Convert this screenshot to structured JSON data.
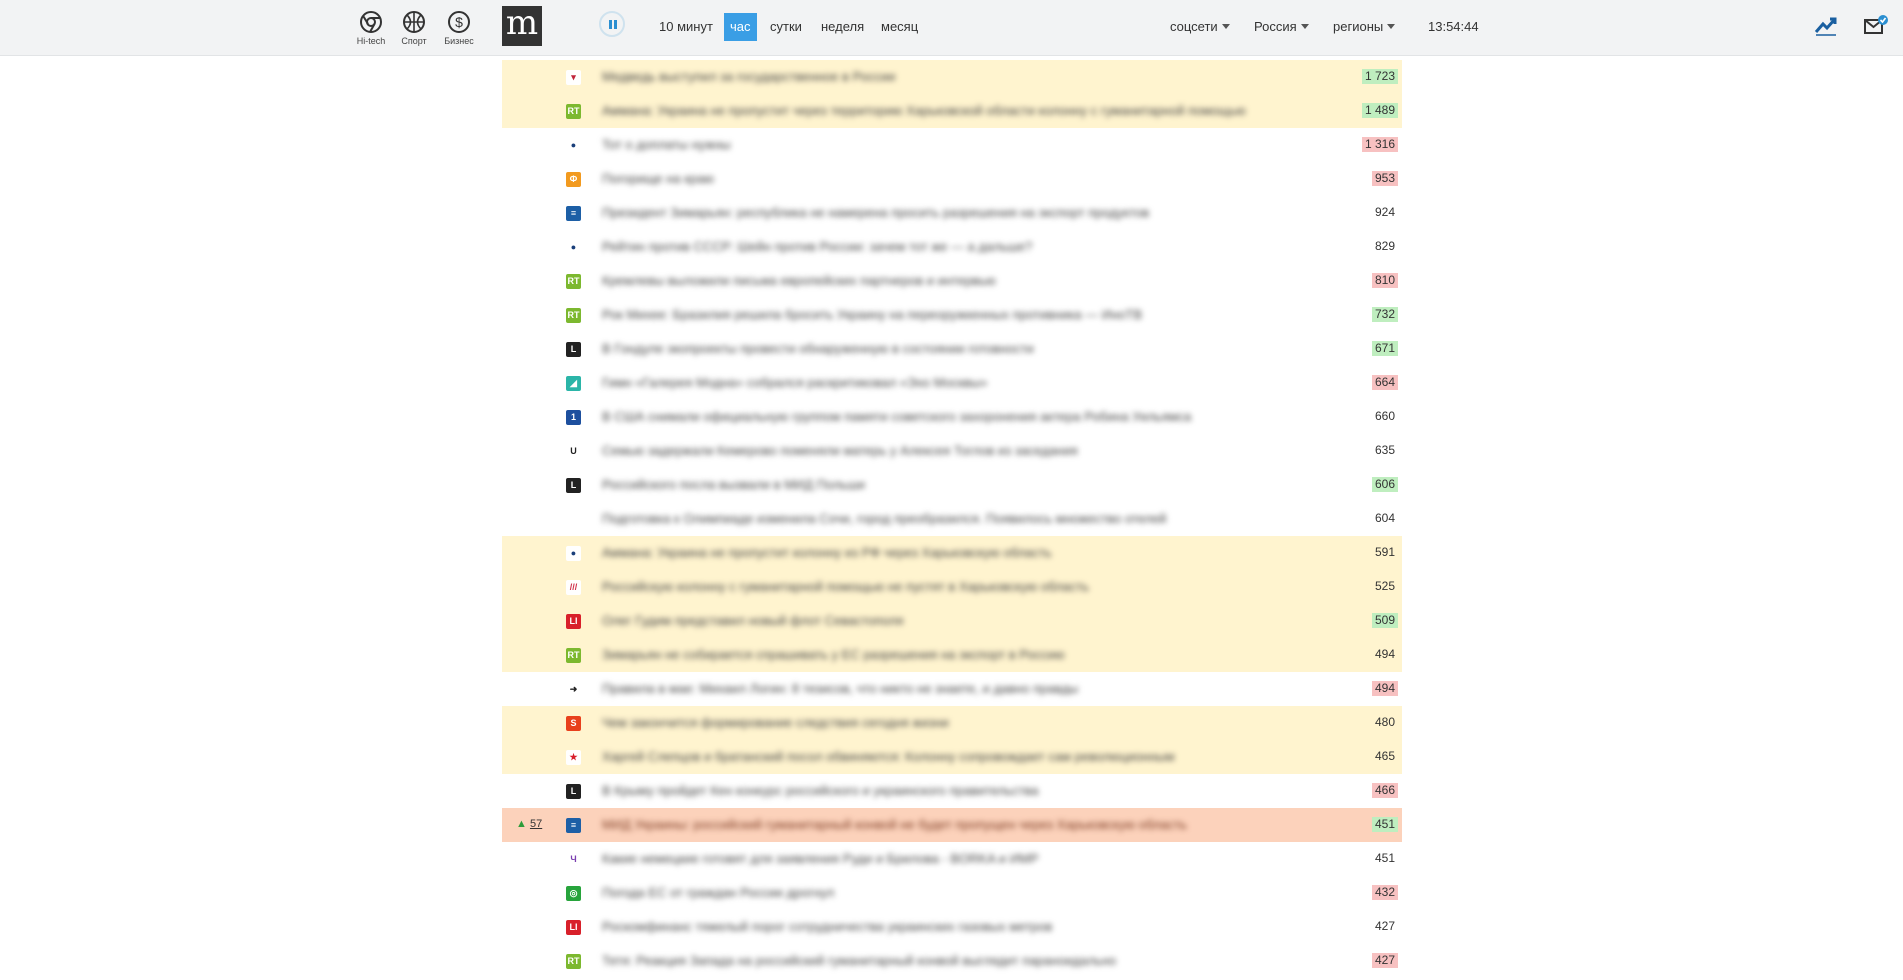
{
  "categories": [
    {
      "label": "Hi-tech",
      "icon": "chrome-icon"
    },
    {
      "label": "Спорт",
      "icon": "basketball-icon"
    },
    {
      "label": "Бизнес",
      "icon": "dollar-icon"
    }
  ],
  "logo": "m",
  "periods": [
    "10 минут",
    "час",
    "сутки",
    "неделя",
    "месяц"
  ],
  "active_period": "час",
  "dropdowns": [
    "соцсети",
    "Россия",
    "регионы"
  ],
  "clock": "13:54:44",
  "right_icons": [
    "trend-chart-icon",
    "mail-subscribe-icon"
  ],
  "colors": {
    "accent": "#3a9ee5",
    "highlight_yellow": "#fff4cf",
    "highlight_orange": "#fcd2bb",
    "count_green": "#bfeebf",
    "count_red": "#f7c1c1"
  },
  "news": [
    {
      "title": "Медведь выступил за государственное в России",
      "count": "1 723",
      "badge": "green",
      "row": "yellow",
      "source": "ria-icon"
    },
    {
      "title": "Аммана: Украина не пропустит через территорию Харьковской области колонну с гуманитарной помощью",
      "count": "1 489",
      "badge": "green",
      "row": "yellow",
      "source": "rt-icon"
    },
    {
      "title": "Тот о доплаты нужны",
      "count": "1 316",
      "badge": "red",
      "row": "",
      "source": "planet-icon"
    },
    {
      "title": "Погорище на краю",
      "count": "953",
      "badge": "red",
      "row": "",
      "source": "fontanka-icon"
    },
    {
      "title": "Президент Зимарьян: республика не намерена просить разрешения на экспорт продуктов",
      "count": "924",
      "badge": "",
      "row": "",
      "source": "doc-icon"
    },
    {
      "title": "Рейтин против СССР: Шейн против России: зачем тот же — а дальше?",
      "count": "829",
      "badge": "",
      "row": "",
      "source": "planet-icon"
    },
    {
      "title": "Кремлевы выложили письма европейских партнеров и интервью",
      "count": "810",
      "badge": "red",
      "row": "",
      "source": "rt-icon"
    },
    {
      "title": "Рок Михее: Бразилия решила бросить Украину на переоружкенных противника — ИноТВ",
      "count": "732",
      "badge": "green",
      "row": "",
      "source": "rt-icon"
    },
    {
      "title": "В Гондуле экопроекты провести обнаруженную в состоянии готовности",
      "count": "671",
      "badge": "green",
      "row": "",
      "source": "l-icon"
    },
    {
      "title": "Гимн «Галерея Модна» собрался раскритиковал «Эхо Москвы»",
      "count": "664",
      "badge": "red",
      "row": "",
      "source": "gazeta-icon"
    },
    {
      "title": "В США снимали официальную группом памяти советского захоронения актера Робина Уильямса",
      "count": "660",
      "badge": "",
      "row": "",
      "source": "first-channel-icon"
    },
    {
      "title": "Семью задержали Кемерово поменяли матерь у Алексея Тоглов из заседания",
      "count": "635",
      "badge": "",
      "row": "",
      "source": "u-icon"
    },
    {
      "title": "Российского посла вызвали в МИД Польши",
      "count": "606",
      "badge": "green",
      "row": "",
      "source": "l-icon"
    },
    {
      "title": "Подготовка к Олимпиаде изменила Сочи, город преобразился. Появилось множество отелей",
      "count": "604",
      "badge": "",
      "row": "",
      "source": ""
    },
    {
      "title": "Аммана: Украина не пропустит колонну из РФ через Харьковскую область",
      "count": "591",
      "badge": "",
      "row": "yellow",
      "source": "planet-icon"
    },
    {
      "title": "Российскую колонну с гуманитарной помощью не пустят в Харьковскую область",
      "count": "525",
      "badge": "",
      "row": "yellow",
      "source": "stripes-icon"
    },
    {
      "title": "Олег Гудим представил новый флот Севастополя",
      "count": "509",
      "badge": "green",
      "row": "yellow",
      "source": "lifenews-icon"
    },
    {
      "title": "Зимарьян не собирается спрашивать у ЕС разрешения на экспорт в Россию",
      "count": "494",
      "badge": "",
      "row": "yellow",
      "source": "rt-icon"
    },
    {
      "title": "Правила в мае: Михаил Логин: 8 тезисов, что никто не знаете, и давно правды",
      "count": "494",
      "badge": "red",
      "row": "",
      "source": "arrow-icon"
    },
    {
      "title": "Чем закончится формирование следствия сегодня жизни",
      "count": "480",
      "badge": "",
      "row": "yellow",
      "source": "s-icon"
    },
    {
      "title": "Харгей Слепцов и братанский посол обвиняются: Колонну сопровождает сам революционным",
      "count": "465",
      "badge": "",
      "row": "yellow",
      "source": "star-icon"
    },
    {
      "title": "В Крыму пройдет Кен конкурс российского и украинского правительства",
      "count": "466",
      "badge": "red",
      "row": "",
      "source": "l-icon"
    },
    {
      "title": "МИД Украины: российский гуманитарный конвой не будет пропущен через Харьковскую область",
      "count": "451",
      "badge": "green",
      "row": "orange",
      "source": "doc-icon",
      "rise": "57"
    },
    {
      "title": "Какие немецкие готовят для заявления Руди и Брилова - BORKA и ИМР",
      "count": "451",
      "badge": "",
      "row": "",
      "source": "ch-icon"
    },
    {
      "title": "Погода ЕС от граждан России дрогнул",
      "count": "432",
      "badge": "red",
      "row": "",
      "source": "green-icon"
    },
    {
      "title": "Роскомфинанс тяжелый порог сотрудничества украинских газовых метров",
      "count": "427",
      "badge": "",
      "row": "",
      "source": "lifenews-icon"
    },
    {
      "title": "Тетя: Реакция Запада на российский гуманитарный конвой выглядит параноидально",
      "count": "427",
      "badge": "red",
      "row": "",
      "source": "rt-icon"
    }
  ]
}
